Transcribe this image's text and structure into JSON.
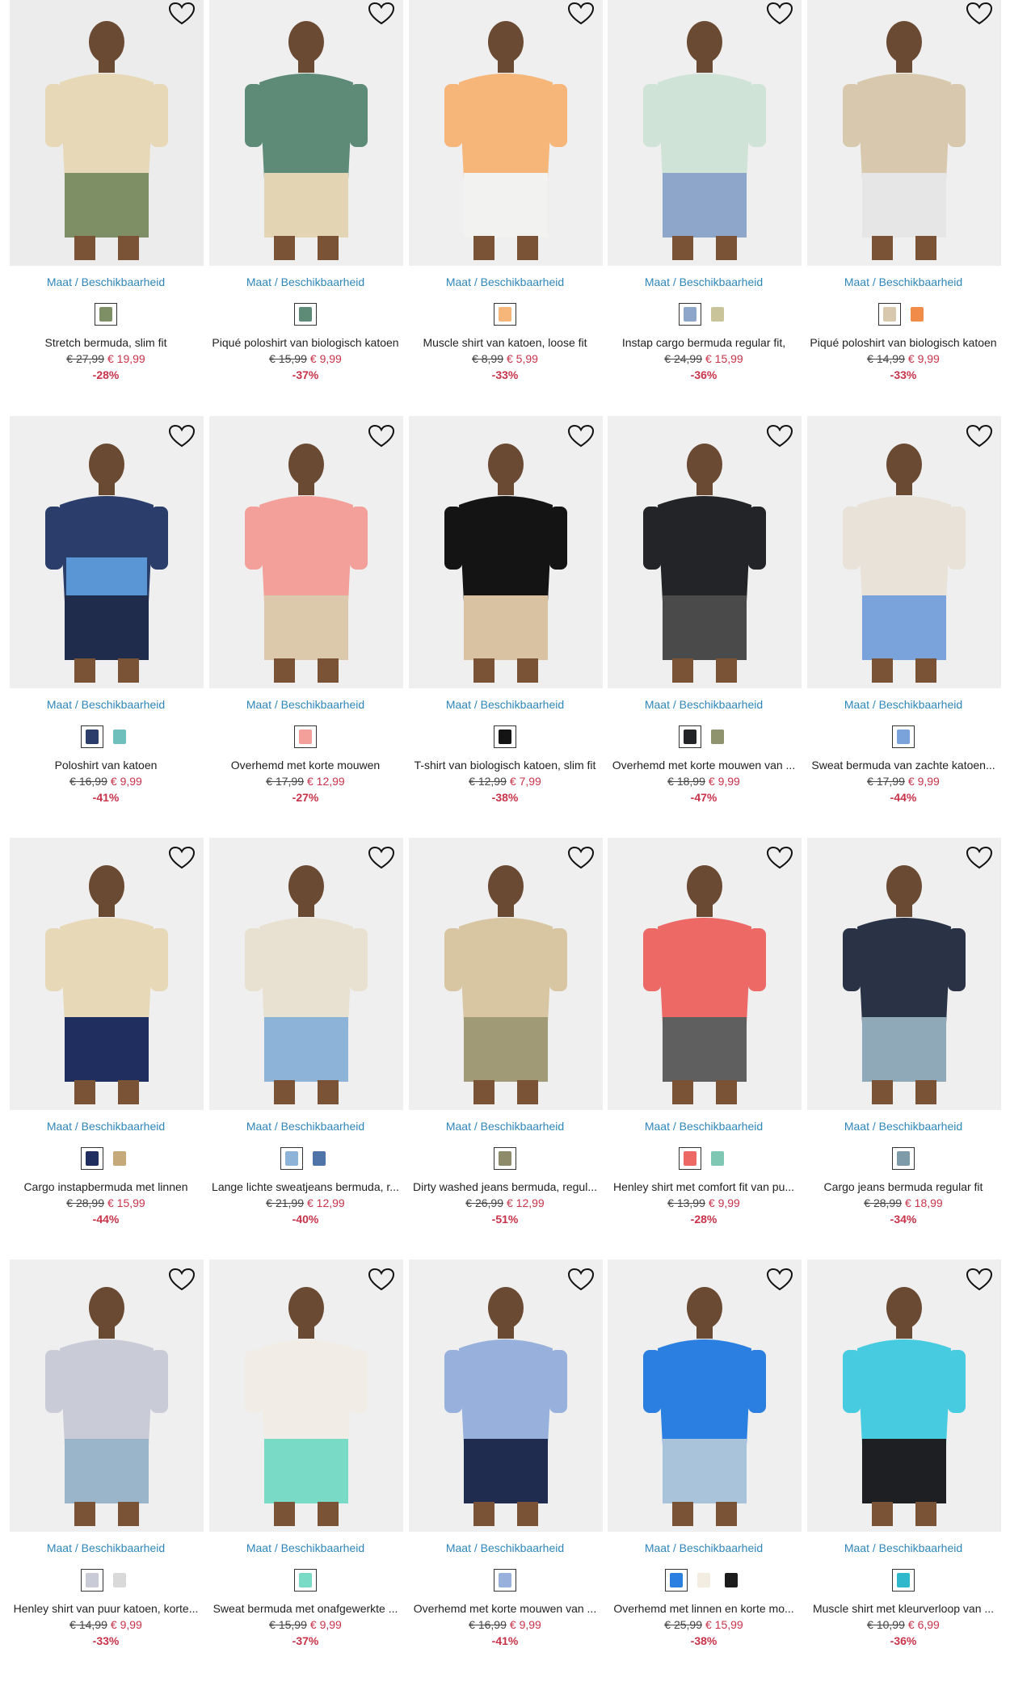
{
  "rows": [
    [
      {
        "name": "Stretch bermuda, slim fit",
        "size": "Maat / Beschikbaarheid",
        "old": "€ 27,99",
        "new": "€ 19,99",
        "disc": "-28%",
        "bg": "#ececec",
        "top": "#e7d8b8",
        "bottom": "#7e8f65",
        "swatches": [
          "#7e8f65"
        ]
      },
      {
        "name": "Piqué poloshirt van biologisch katoen",
        "size": "Maat / Beschikbaarheid",
        "old": "€ 15,99",
        "new": "€ 9,99",
        "disc": "-37%",
        "bg": "#efefef",
        "top": "#5e8a78",
        "bottom": "#e3d5b3",
        "swatches": [
          "#5e8a78"
        ]
      },
      {
        "name": "Muscle shirt van katoen, loose fit",
        "size": "Maat / Beschikbaarheid",
        "old": "€ 8,99",
        "new": "€ 5,99",
        "disc": "-33%",
        "bg": "#efefef",
        "top": "#f6b67a",
        "bottom": "#f2f2f0",
        "swatches": [
          "#f6b67a"
        ]
      },
      {
        "name": "Instap cargo bermuda regular fit,",
        "size": "Maat / Beschikbaarheid",
        "old": "€ 24,99",
        "new": "€ 15,99",
        "disc": "-36%",
        "bg": "#efefef",
        "top": "#cfe3d6",
        "bottom": "#8ea6c9",
        "swatches": [
          "#8ea6c9",
          "#c9c49a"
        ]
      },
      {
        "name": "Piqué poloshirt van biologisch katoen",
        "size": "Maat / Beschikbaarheid",
        "old": "€ 14,99",
        "new": "€ 9,99",
        "disc": "-33%",
        "bg": "#efefef",
        "top": "#d8c9ae",
        "bottom": "#e6e6e6",
        "swatches": [
          "#d8c9ae",
          "#f08b4a"
        ]
      }
    ],
    [
      {
        "name": "Poloshirt van katoen",
        "size": "Maat / Beschikbaarheid",
        "old": "€ 16,99",
        "new": "€ 9,99",
        "disc": "-41%",
        "bg": "#efefef",
        "top": "#2b3e6b",
        "bottom": "#1f2c4c",
        "top2": "#5a96d6",
        "swatches": [
          "#2b3e6b",
          "#6fc0bd"
        ]
      },
      {
        "name": "Overhemd met korte mouwen",
        "size": "Maat / Beschikbaarheid",
        "old": "€ 17,99",
        "new": "€ 12,99",
        "disc": "-27%",
        "bg": "#efefef",
        "top": "#f3a09a",
        "bottom": "#dcc9ab",
        "swatches": [
          "#f3a09a"
        ]
      },
      {
        "name": "T-shirt van biologisch katoen, slim fit",
        "size": "Maat / Beschikbaarheid",
        "old": "€ 12,99",
        "new": "€ 7,99",
        "disc": "-38%",
        "bg": "#efefef",
        "top": "#141414",
        "bottom": "#d8c2a1",
        "swatches": [
          "#141414"
        ]
      },
      {
        "name": "Overhemd met korte mouwen van ...",
        "size": "Maat / Beschikbaarheid",
        "old": "€ 18,99",
        "new": "€ 9,99",
        "disc": "-47%",
        "bg": "#efefef",
        "top": "#222428",
        "bottom": "#4a4a4a",
        "swatches": [
          "#222428",
          "#8f946e"
        ]
      },
      {
        "name": "Sweat bermuda van zachte katoen...",
        "size": "Maat / Beschikbaarheid",
        "old": "€ 17,99",
        "new": "€ 9,99",
        "disc": "-44%",
        "bg": "#efefef",
        "top": "#e8e2d8",
        "bottom": "#7aa3dc",
        "swatches": [
          "#7aa3dc"
        ]
      }
    ],
    [
      {
        "name": "Cargo instapbermuda met linnen",
        "size": "Maat / Beschikbaarheid",
        "old": "€ 28,99",
        "new": "€ 15,99",
        "disc": "-44%",
        "bg": "#efefef",
        "top": "#e7d8b8",
        "bottom": "#1f2e5e",
        "swatches": [
          "#1f2e5e",
          "#c5a978"
        ]
      },
      {
        "name": "Lange lichte sweatjeans bermuda, r...",
        "size": "Maat / Beschikbaarheid",
        "old": "€ 21,99",
        "new": "€ 12,99",
        "disc": "-40%",
        "bg": "#efefef",
        "top": "#e8e0d0",
        "bottom": "#8db3d9",
        "swatches": [
          "#8db3d9",
          "#4e74a8"
        ]
      },
      {
        "name": "Dirty washed jeans bermuda, regul...",
        "size": "Maat / Beschikbaarheid",
        "old": "€ 26,99",
        "new": "€ 12,99",
        "disc": "-51%",
        "bg": "#efefef",
        "top": "#d8c6a3",
        "bottom": "#a09a76",
        "swatches": [
          "#8e8b6b"
        ]
      },
      {
        "name": "Henley shirt met comfort fit van pu...",
        "size": "Maat / Beschikbaarheid",
        "old": "€ 13,99",
        "new": "€ 9,99",
        "disc": "-28%",
        "bg": "#efefef",
        "top": "#ec6966",
        "bottom": "#5f5f5f",
        "swatches": [
          "#ec6966",
          "#7fc7b2"
        ]
      },
      {
        "name": "Cargo jeans bermuda regular fit",
        "size": "Maat / Beschikbaarheid",
        "old": "€ 28,99",
        "new": "€ 18,99",
        "disc": "-34%",
        "bg": "#efefef",
        "top": "#2a3346",
        "bottom": "#8fa9b9",
        "swatches": [
          "#7f9aa8"
        ]
      }
    ],
    [
      {
        "name": "Henley shirt van puur katoen, korte...",
        "size": "Maat / Beschikbaarheid",
        "old": "€ 14,99",
        "new": "€ 9,99",
        "disc": "-33%",
        "bg": "#efefef",
        "top": "#c9ccd6",
        "bottom": "#9ab4c9",
        "swatches": [
          "#c9ccd6",
          "#d9d9d9"
        ]
      },
      {
        "name": "Sweat bermuda met onafgewerkte ...",
        "size": "Maat / Beschikbaarheid",
        "old": "€ 15,99",
        "new": "€ 9,99",
        "disc": "-37%",
        "bg": "#efefef",
        "top": "#f1ede6",
        "bottom": "#79dbc5",
        "swatches": [
          "#79dbc5"
        ]
      },
      {
        "name": "Overhemd met korte mouwen van ...",
        "size": "Maat / Beschikbaarheid",
        "old": "€ 16,99",
        "new": "€ 9,99",
        "disc": "-41%",
        "bg": "#efefef",
        "top": "#98b1dc",
        "bottom": "#1f2b4f",
        "swatches": [
          "#98b1dc"
        ]
      },
      {
        "name": "Overhemd met linnen en korte mo...",
        "size": "Maat / Beschikbaarheid",
        "old": "€ 25,99",
        "new": "€ 15,99",
        "disc": "-38%",
        "bg": "#efefef",
        "top": "#2b7fe0",
        "bottom": "#a8c3da",
        "swatches": [
          "#2b7fe0",
          "#f2ece1",
          "#1c1c1c"
        ]
      },
      {
        "name": "Muscle shirt met kleurverloop van ...",
        "size": "Maat / Beschikbaarheid",
        "old": "€ 10,99",
        "new": "€ 6,99",
        "disc": "-36%",
        "bg": "#efefef",
        "top": "#46cbe0",
        "bottom": "#1d1f22",
        "swatches": [
          "#2fb8cc"
        ]
      }
    ]
  ]
}
